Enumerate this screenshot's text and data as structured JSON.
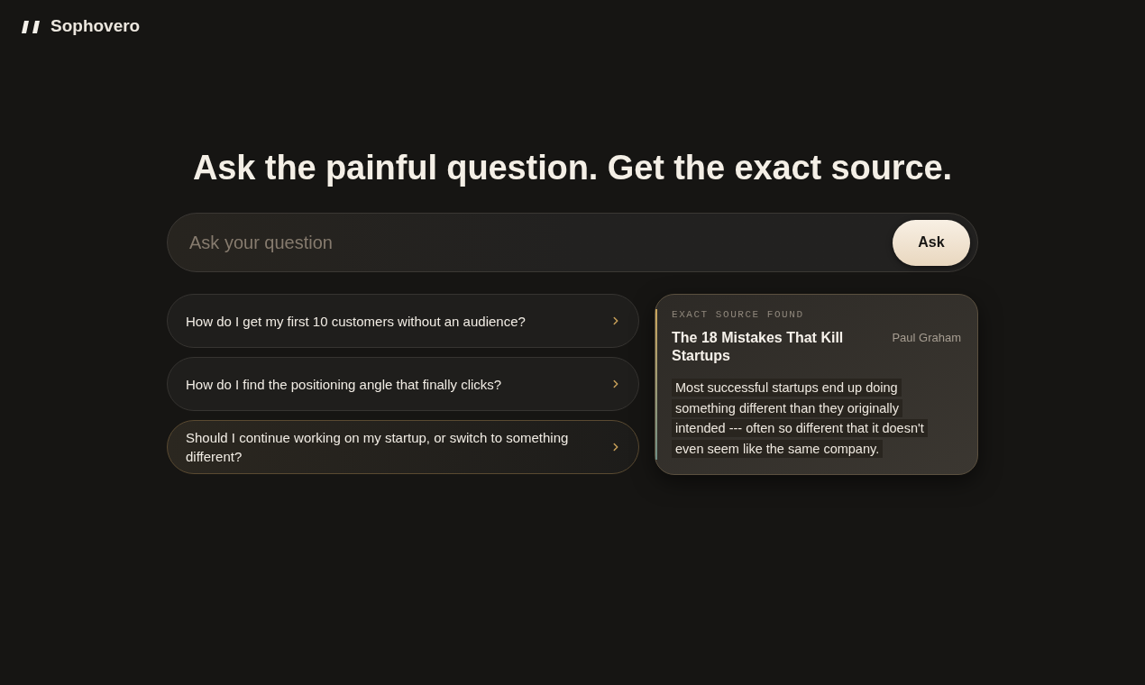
{
  "brand": {
    "name": "Sophovero"
  },
  "headline": "Ask the painful question. Get the exact source.",
  "search": {
    "placeholder": "Ask your question",
    "button": "Ask"
  },
  "suggestions": [
    {
      "text": "How do I get my first 10 customers without an audience?",
      "selected": false
    },
    {
      "text": "How do I find the positioning angle that finally clicks?",
      "selected": false
    },
    {
      "text": "Should I continue working on my startup, or switch to something different?",
      "selected": true
    }
  ],
  "source_card": {
    "label": "EXACT SOURCE FOUND",
    "title": "The 18 Mistakes That Kill Startups",
    "author": "Paul Graham",
    "quote": "Most successful startups end up doing something different than they originally intended --- often so different that it doesn't even seem like the same company."
  }
}
